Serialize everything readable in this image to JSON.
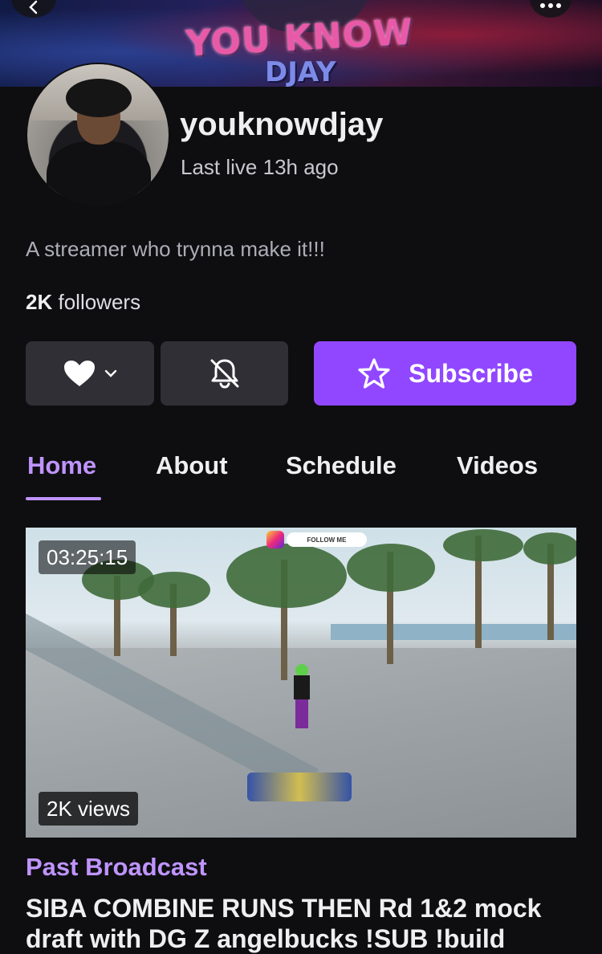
{
  "banner": {
    "text_line1": "YOU KNOW",
    "text_line2": "DJAY",
    "back_icon": "chevron-left-icon",
    "more_icon": "more-dots-icon"
  },
  "channel": {
    "username": "youknowdjay",
    "status": "Last live 13h ago",
    "bio": "A streamer who trynna make it!!!",
    "followers_count": "2K",
    "followers_label": "followers"
  },
  "actions": {
    "follow_icon": "heart-icon",
    "follow_dropdown_icon": "chevron-down-icon",
    "notify_icon": "bell-off-icon",
    "subscribe_icon": "star-icon",
    "subscribe_label": "Subscribe"
  },
  "tabs": [
    {
      "label": "Home",
      "active": true
    },
    {
      "label": "About",
      "active": false
    },
    {
      "label": "Schedule",
      "active": false
    },
    {
      "label": "Videos",
      "active": false
    }
  ],
  "video": {
    "overlay_follow_text": "FOLLOW ME",
    "duration": "03:25:15",
    "views": "2K views",
    "type": "Past Broadcast",
    "title": "SIBA COMBINE RUNS THEN Rd 1&2 mock draft with DG Z angelbucks !SUB !build"
  },
  "colors": {
    "background": "#0e0e10",
    "accent": "#9147ff",
    "accent_text": "#bf94ff",
    "button": "#2f2f35"
  }
}
